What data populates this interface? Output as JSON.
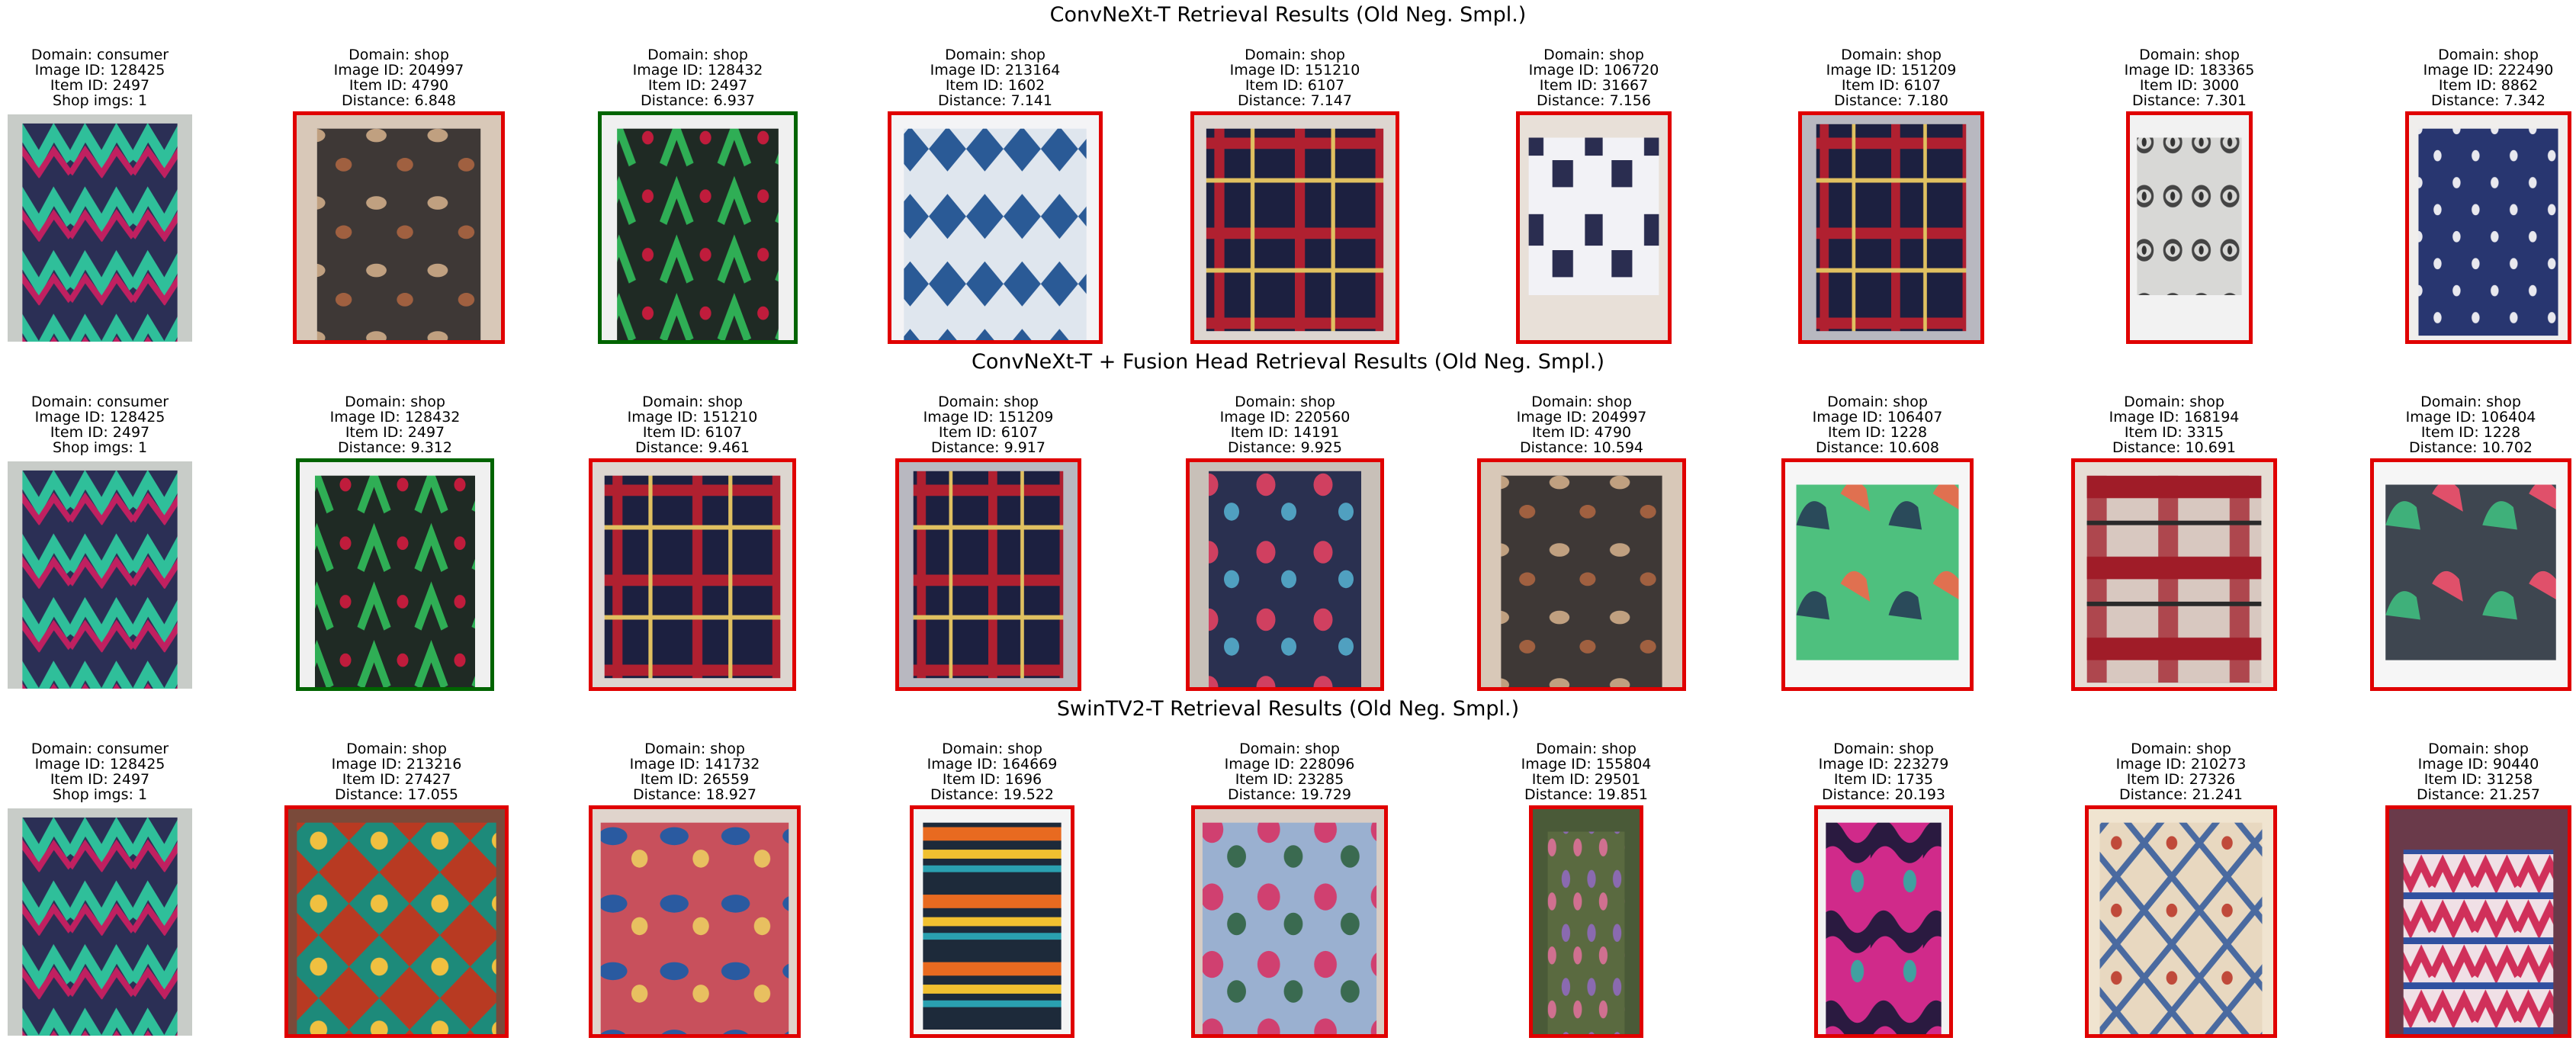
{
  "colors": {
    "match_border": "#006400",
    "nomatch_border": "#e00000"
  },
  "labels": {
    "domain": "Domain: ",
    "image_id": "Image ID: ",
    "item_id": "Item ID: ",
    "shop_imgs": "Shop imgs: ",
    "distance": "Distance: "
  },
  "sections": [
    {
      "title": "ConvNeXt-T Retrieval Results (Old Neg. Smpl.)",
      "query": {
        "domain": "consumer",
        "image_id": "128425",
        "item_id": "2497",
        "shop_imgs": "1",
        "image_name": "query-sweater-photo"
      },
      "results": [
        {
          "domain": "shop",
          "image_id": "204997",
          "item_id": "4790",
          "distance": "6.848",
          "match": false,
          "image_name": "brown-patterned-shirt-photo"
        },
        {
          "domain": "shop",
          "image_id": "128432",
          "item_id": "2497",
          "distance": "6.937",
          "match": true,
          "image_name": "green-patterned-cardigan-photo"
        },
        {
          "domain": "shop",
          "image_id": "213164",
          "item_id": "1602",
          "distance": "7.141",
          "match": false,
          "image_name": "blue-aztec-jacket-photo"
        },
        {
          "domain": "shop",
          "image_id": "151210",
          "item_id": "6107",
          "distance": "7.147",
          "match": false,
          "image_name": "plaid-shirt-photo"
        },
        {
          "domain": "shop",
          "image_id": "106720",
          "item_id": "31667",
          "distance": "7.156",
          "match": false,
          "image_name": "graphic-tee-photo"
        },
        {
          "domain": "shop",
          "image_id": "151209",
          "item_id": "6107",
          "distance": "7.180",
          "match": false,
          "image_name": "dark-plaid-shirt-photo"
        },
        {
          "domain": "shop",
          "image_id": "183365",
          "item_id": "3000",
          "distance": "7.301",
          "match": false,
          "image_name": "white-knit-sweater-photo"
        },
        {
          "domain": "shop",
          "image_id": "222490",
          "item_id": "8862",
          "distance": "7.342",
          "match": false,
          "image_name": "navy-star-jacket-photo"
        }
      ]
    },
    {
      "title": "ConvNeXt-T + Fusion Head Retrieval Results (Old Neg. Smpl.)",
      "query": {
        "domain": "consumer",
        "image_id": "128425",
        "item_id": "2497",
        "shop_imgs": "1",
        "image_name": "query-sweater-photo"
      },
      "results": [
        {
          "domain": "shop",
          "image_id": "128432",
          "item_id": "2497",
          "distance": "9.312",
          "match": true,
          "image_name": "green-patterned-cardigan-photo"
        },
        {
          "domain": "shop",
          "image_id": "151210",
          "item_id": "6107",
          "distance": "9.461",
          "match": false,
          "image_name": "plaid-shirt-photo"
        },
        {
          "domain": "shop",
          "image_id": "151209",
          "item_id": "6107",
          "distance": "9.917",
          "match": false,
          "image_name": "dark-plaid-shirt-photo"
        },
        {
          "domain": "shop",
          "image_id": "220560",
          "item_id": "14191",
          "distance": "9.925",
          "match": false,
          "image_name": "floral-sleeve-jacket-photo"
        },
        {
          "domain": "shop",
          "image_id": "204997",
          "item_id": "4790",
          "distance": "10.594",
          "match": false,
          "image_name": "brown-patterned-shirt-photo"
        },
        {
          "domain": "shop",
          "image_id": "106407",
          "item_id": "1228",
          "distance": "10.608",
          "match": false,
          "image_name": "green-dinosaur-tee-photo"
        },
        {
          "domain": "shop",
          "image_id": "168194",
          "item_id": "3315",
          "distance": "10.691",
          "match": false,
          "image_name": "red-plaid-shirt-photo"
        },
        {
          "domain": "shop",
          "image_id": "106404",
          "item_id": "1228",
          "distance": "10.702",
          "match": false,
          "image_name": "grey-dinosaur-tee-photo"
        }
      ]
    },
    {
      "title": "SwinTV2-T Retrieval Results (Old Neg. Smpl.)",
      "query": {
        "domain": "consumer",
        "image_id": "128425",
        "item_id": "2497",
        "shop_imgs": "1",
        "image_name": "query-sweater-photo"
      },
      "results": [
        {
          "domain": "shop",
          "image_id": "213216",
          "item_id": "27427",
          "distance": "17.055",
          "match": false,
          "image_name": "ethnic-kimono-photo"
        },
        {
          "domain": "shop",
          "image_id": "141732",
          "item_id": "26559",
          "distance": "18.927",
          "match": false,
          "image_name": "paisley-blouse-photo"
        },
        {
          "domain": "shop",
          "image_id": "164669",
          "item_id": "1696",
          "distance": "19.522",
          "match": false,
          "image_name": "striped-collar-sweater-photo"
        },
        {
          "domain": "shop",
          "image_id": "228096",
          "item_id": "23285",
          "distance": "19.729",
          "match": false,
          "image_name": "floral-wrap-top-photo"
        },
        {
          "domain": "shop",
          "image_id": "155804",
          "item_id": "29501",
          "distance": "19.851",
          "match": false,
          "image_name": "floral-maxi-dress-photo"
        },
        {
          "domain": "shop",
          "image_id": "223279",
          "item_id": "1735",
          "distance": "20.193",
          "match": false,
          "image_name": "camo-jersey-photo"
        },
        {
          "domain": "shop",
          "image_id": "210273",
          "item_id": "27326",
          "distance": "21.241",
          "match": false,
          "image_name": "boho-cardigan-photo"
        },
        {
          "domain": "shop",
          "image_id": "90440",
          "item_id": "31258",
          "distance": "21.257",
          "match": false,
          "image_name": "pink-tribal-top-photo"
        }
      ]
    }
  ]
}
